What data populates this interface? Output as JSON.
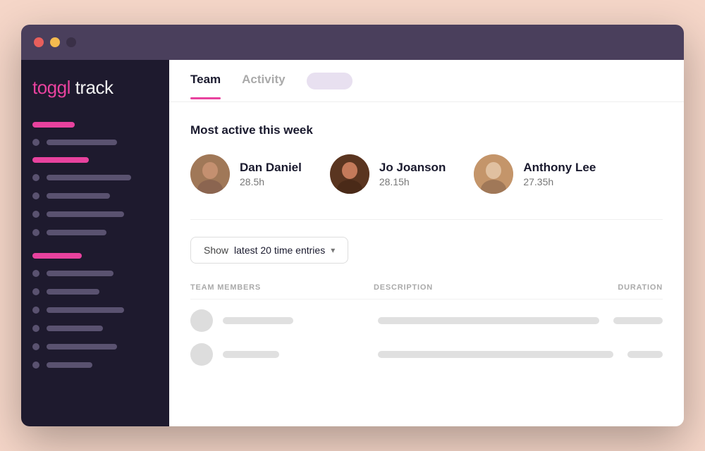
{
  "window": {
    "titlebar": {
      "dot_red": "close",
      "dot_yellow": "minimize",
      "dot_dark": "fullscreen"
    }
  },
  "sidebar": {
    "logo": "toggl",
    "logo_suffix": " track",
    "nav_items": [
      {
        "type": "bar",
        "width": 60,
        "color": "pink"
      },
      {
        "type": "item",
        "dot": true,
        "width": 100
      },
      {
        "type": "bar",
        "width": 80,
        "color": "pink"
      },
      {
        "type": "item",
        "dot": true,
        "width": 120
      },
      {
        "type": "item",
        "dot": true,
        "width": 90
      },
      {
        "type": "item",
        "dot": true,
        "width": 110
      },
      {
        "type": "item",
        "dot": true,
        "width": 85
      },
      {
        "type": "bar",
        "width": 70,
        "color": "pink"
      },
      {
        "type": "item",
        "dot": true,
        "width": 95
      },
      {
        "type": "item",
        "dot": true,
        "width": 75
      },
      {
        "type": "item",
        "dot": true,
        "width": 110
      },
      {
        "type": "item",
        "dot": true,
        "width": 80
      },
      {
        "type": "item",
        "dot": true,
        "width": 100
      },
      {
        "type": "item",
        "dot": true,
        "width": 65
      }
    ]
  },
  "tabs": {
    "items": [
      {
        "id": "team",
        "label": "Team",
        "active": true
      },
      {
        "id": "activity",
        "label": "Activity",
        "active": false
      }
    ]
  },
  "main": {
    "section_title": "Most active this week",
    "active_users": [
      {
        "id": "dan",
        "name": "Dan Daniel",
        "hours": "28.5h",
        "face_class": "face-dan"
      },
      {
        "id": "jo",
        "name": "Jo Joanson",
        "hours": "28.15h",
        "face_class": "face-jo"
      },
      {
        "id": "anthony",
        "name": "Anthony Lee",
        "hours": "27.35h",
        "face_class": "face-anthony"
      }
    ],
    "filter": {
      "show_label": "Show",
      "value": "latest 20 time entries",
      "chevron": "▾"
    },
    "table": {
      "headers": {
        "team": "TEAM MEMBERS",
        "description": "DESCRIPTION",
        "duration": "DURATION"
      }
    }
  }
}
